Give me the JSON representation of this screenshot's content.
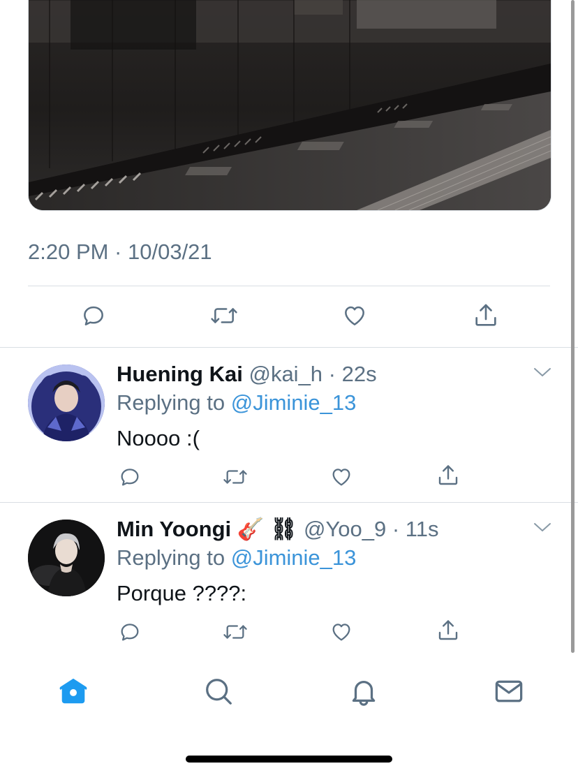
{
  "tweet": {
    "timestamp": "2:20 PM · 10/03/21"
  },
  "actions": {
    "reply_icon": "reply-icon",
    "retweet_icon": "retweet-icon",
    "like_icon": "heart-icon",
    "share_icon": "share-icon"
  },
  "replies": [
    {
      "display_name": "Huening Kai",
      "handle_time": "@kai_h · 22s",
      "replying_prefix": "Replying to ",
      "replying_to": "@Jiminie_13",
      "text": "Noooo :("
    },
    {
      "display_name": "Min Yoongi 🎸 ⛓",
      "handle_time": "@Yoo_9 · 11s",
      "replying_prefix": "Replying to ",
      "replying_to": "@Jiminie_13",
      "text": "Porque ????:"
    }
  ],
  "tabbar": {
    "items": [
      "home-icon",
      "search-icon",
      "notifications-icon",
      "messages-icon"
    ],
    "active": "home-icon"
  },
  "colors": {
    "accent": "#1d9bf0",
    "muted": "#5b7083",
    "separator": "#d9dee3"
  }
}
